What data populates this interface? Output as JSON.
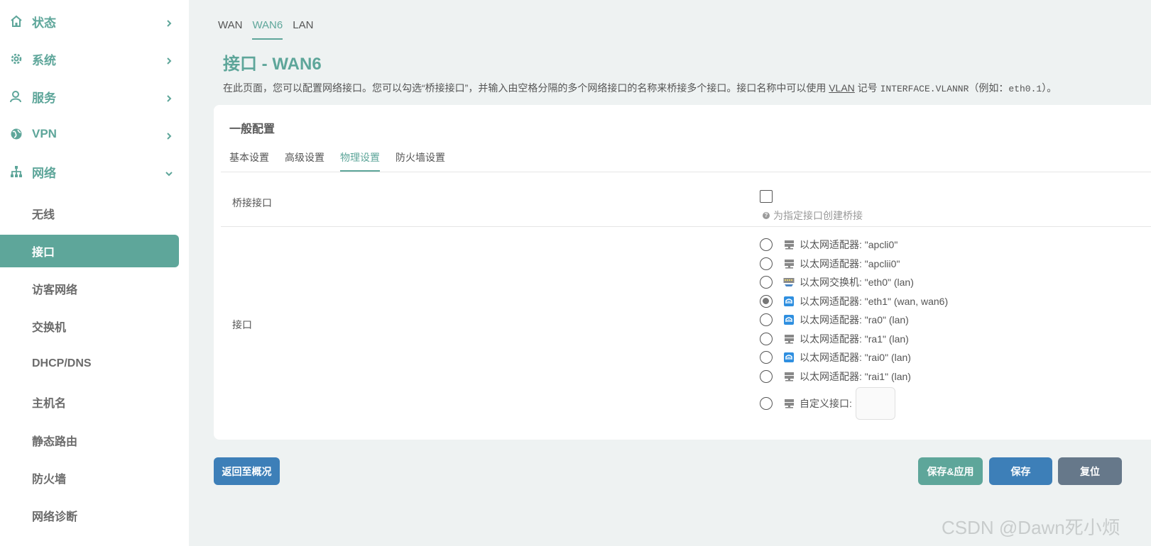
{
  "sidebar": {
    "top_items": [
      {
        "label": "状态",
        "icon": "home-icon",
        "expanded": false
      },
      {
        "label": "系统",
        "icon": "gear-icon",
        "expanded": false
      },
      {
        "label": "服务",
        "icon": "user-icon",
        "expanded": false
      },
      {
        "label": "VPN",
        "icon": "globe-icon",
        "expanded": false
      },
      {
        "label": "网络",
        "icon": "network-icon",
        "expanded": true
      }
    ],
    "sub_items": [
      {
        "label": "无线",
        "active": false
      },
      {
        "label": "接口",
        "active": true
      },
      {
        "label": "访客网络",
        "active": false
      },
      {
        "label": "交换机",
        "active": false
      },
      {
        "label": "DHCP/DNS",
        "active": false
      },
      {
        "label": "主机名",
        "active": false
      },
      {
        "label": "静态路由",
        "active": false
      },
      {
        "label": "防火墙",
        "active": false
      },
      {
        "label": "网络诊断",
        "active": false
      }
    ]
  },
  "top_tabs": [
    {
      "label": "WAN",
      "active": false
    },
    {
      "label": "WAN6",
      "active": true
    },
    {
      "label": "LAN",
      "active": false
    }
  ],
  "page": {
    "title": "接口 - WAN6",
    "desc_part1": "在此页面，您可以配置网络接口。您可以勾选“桥接接口”，并输入由空格分隔的多个网络接口的名称来桥接多个接口。接口名称中可以使用 ",
    "desc_link": "VLAN",
    "desc_part2": " 记号 ",
    "desc_code": "INTERFACE.VLANNR",
    "desc_part3": "（例如：",
    "desc_example": "eth0.1",
    "desc_part4": "）。"
  },
  "section": {
    "title": "一般配置",
    "tabs": [
      {
        "label": "基本设置",
        "active": false
      },
      {
        "label": "高级设置",
        "active": false
      },
      {
        "label": "物理设置",
        "active": true
      },
      {
        "label": "防火墙设置",
        "active": false
      }
    ]
  },
  "bridge": {
    "label": "桥接接口",
    "checked": false,
    "hint": "为指定接口创建桥接"
  },
  "interfaces": {
    "label": "接口",
    "items": [
      {
        "label": "以太网适配器: \"apcli0\"",
        "icon": "ethernet-adapter-icon",
        "checked": false
      },
      {
        "label": "以太网适配器: \"apclii0\"",
        "icon": "ethernet-adapter-icon",
        "checked": false
      },
      {
        "label": "以太网交换机: \"eth0\" (lan)",
        "icon": "ethernet-switch-icon",
        "checked": false
      },
      {
        "label": "以太网适配器: \"eth1\" (wan, wan6)",
        "icon": "wifi-adapter-icon",
        "checked": true
      },
      {
        "label": "以太网适配器: \"ra0\" (lan)",
        "icon": "wifi-adapter-icon",
        "checked": false
      },
      {
        "label": "以太网适配器: \"ra1\" (lan)",
        "icon": "ethernet-adapter-icon",
        "checked": false
      },
      {
        "label": "以太网适配器: \"rai0\" (lan)",
        "icon": "wifi-adapter-icon",
        "checked": false
      },
      {
        "label": "以太网适配器: \"rai1\" (lan)",
        "icon": "ethernet-adapter-icon",
        "checked": false
      }
    ],
    "custom_label": "自定义接口:",
    "custom_value": ""
  },
  "buttons": {
    "back": "返回至概况",
    "save_apply": "保存&应用",
    "save": "保存",
    "reset": "复位"
  },
  "watermark": "CSDN @Dawn死小烦",
  "colors": {
    "accent": "#5ea69a",
    "primary": "#3d7fb8",
    "reset": "#66788a",
    "background": "#eef2f2"
  }
}
